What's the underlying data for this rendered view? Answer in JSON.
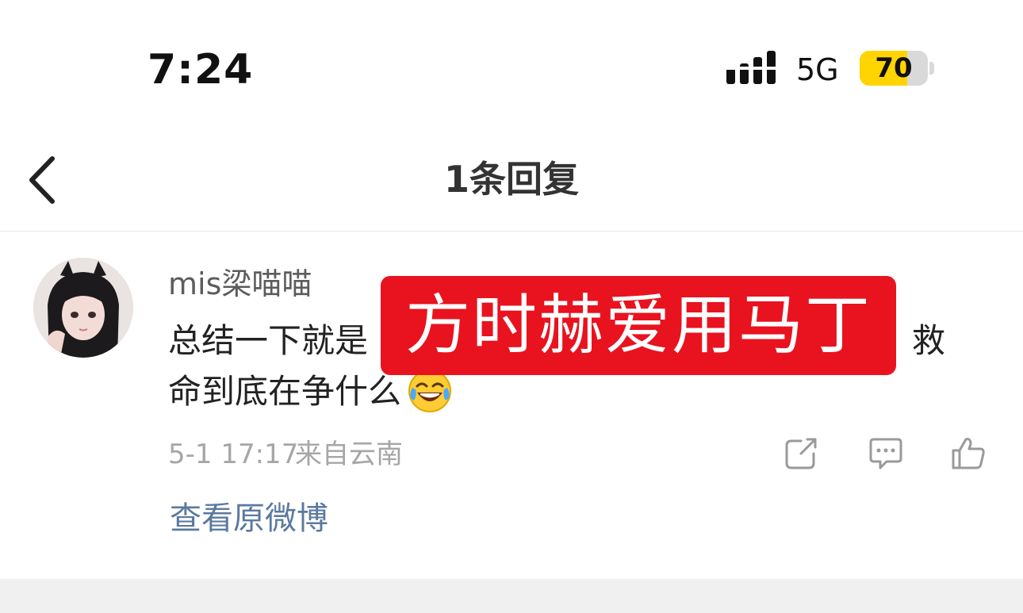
{
  "status_bar": {
    "time": "7:24",
    "network": "5G",
    "battery_level": "70",
    "battery_fraction": 0.7,
    "signal_icon": "signal-bars-icon",
    "battery_color": "#ffd400"
  },
  "nav": {
    "back_icon": "chevron-left-icon",
    "title": "1条回复"
  },
  "comment": {
    "username": "mis梁喵喵",
    "text_line1_start": "总结一下就是",
    "text_line1_end": "救",
    "text_line2": "命到底在争什么",
    "emoji_icon": "laughing-crying-emoji-icon",
    "date": "5-1 17:17",
    "location": "来自云南",
    "actions": {
      "share_icon": "share-icon",
      "comment_icon": "comment-bubble-icon",
      "like_icon": "thumbs-up-icon"
    },
    "view_original_label": "查看原微博"
  },
  "overlay": {
    "text": "方时赫爱用马丁",
    "background_color": "#e8131f"
  }
}
